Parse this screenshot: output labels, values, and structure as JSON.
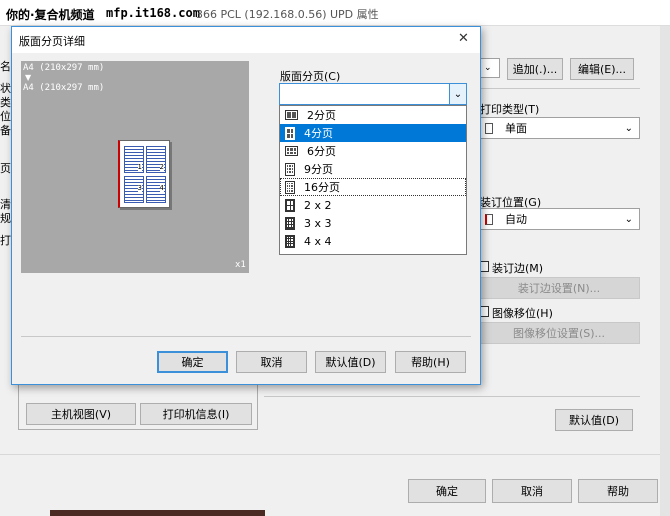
{
  "watermark": "你的·复合机频道",
  "watermark_url": "mfp.it168.com",
  "bg_window_title": "366 PCL (192.168.0.56) UPD 属性",
  "bg_window_ip_prefix": "",
  "bg": {
    "add_button": "追加(.)...",
    "edit_button": "编辑(E)...",
    "print_type_label": "打印类型(T)",
    "print_type_value": "单面",
    "binding_pos_label": "装订位置(G)",
    "binding_pos_value": "自动",
    "binding_margin_label": "装订边(M)",
    "binding_settings_button": "装订边设置(N)...",
    "image_shift_label": "图像移位(H)",
    "image_shift_settings_button": "图像移位设置(S)...",
    "host_view_button": "主机视图(V)",
    "printer_info_button": "打印机信息(I)",
    "default_button": "默认值(D)",
    "ok_button": "确定",
    "cancel_button": "取消",
    "help_button": "帮助",
    "left_chars": [
      "名",
      "状",
      "类",
      "位",
      "备",
      "页",
      "清",
      "规",
      "打"
    ]
  },
  "dialog": {
    "title": "版面分页详细",
    "close": "✕",
    "preview_line1": "A4 (210x297 mm)",
    "preview_arrow": "▼",
    "preview_line2": "A4 (210x297 mm)",
    "preview_scale": "x1",
    "mini_page_numbers": [
      "1",
      "2",
      "3",
      "4"
    ],
    "layout_label": "版面分页(C)",
    "dropdown_options": [
      {
        "label": "2分页",
        "icon": "two-up-icon",
        "selected": false
      },
      {
        "label": "4分页",
        "icon": "four-up-icon",
        "selected": true
      },
      {
        "label": "6分页",
        "icon": "six-up-icon",
        "selected": false
      },
      {
        "label": "9分页",
        "icon": "nine-up-icon",
        "selected": false
      },
      {
        "label": "16分页",
        "icon": "sixteen-up-icon",
        "selected": false
      },
      {
        "label": "2 x 2",
        "icon": "poster-2x2-icon",
        "selected": false
      },
      {
        "label": "3 x 3",
        "icon": "poster-3x3-icon",
        "selected": false
      },
      {
        "label": "4 x 4",
        "icon": "poster-4x4-icon",
        "selected": false
      }
    ],
    "ok_button": "确定",
    "cancel_button": "取消",
    "default_button": "默认值(D)",
    "help_button": "帮助(H)"
  }
}
